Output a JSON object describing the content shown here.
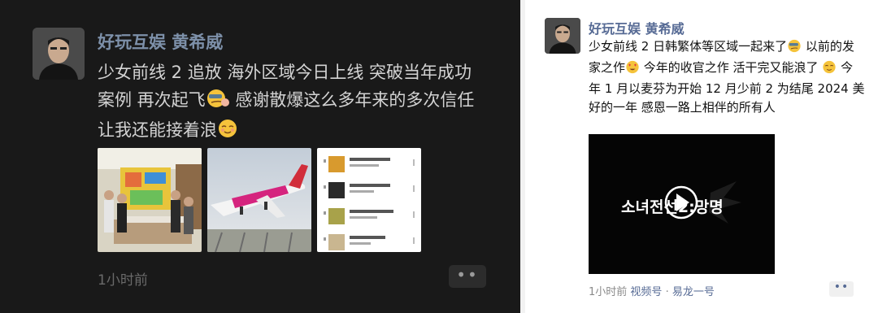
{
  "left_post": {
    "author": "好玩互娱 黄希威",
    "text_1": "少女前线 2 追放 海外区域今日上线 突破当年成功案例 再次起飞",
    "text_2": " 感谢散爆这么多年来的多次信任 让我还能接着浪",
    "emoji_1": "smirk-emoji",
    "emoji_2": "smug-emoji",
    "images": [
      {
        "icon": "office-party-photo"
      },
      {
        "icon": "airplane-photo"
      },
      {
        "icon": "music-chart-screenshot"
      }
    ],
    "time": "1小时前",
    "more": "••"
  },
  "right_post": {
    "author": "好玩互娱 黄希威",
    "text_1": "少女前线 2 日韩繁体等区域一起来了",
    "text_2": " 以前的发家之作",
    "text_3": " 今年的收官之作 活干完又能浪了 ",
    "text_4": " 今年 1 月以麦芬为开始 12 月少前 2 为结尾  2024 美好的一年 感恩一路上相伴的所有人",
    "video_title": "소녀전선2:망명",
    "time": "1小时前",
    "source_label": "视频号",
    "separator": "·",
    "source_name": "易龙一号",
    "more": "••"
  },
  "colors": {
    "dark_bg": "#191919",
    "name_blue_dark": "#7d90a9",
    "name_blue_light": "#576b95"
  }
}
